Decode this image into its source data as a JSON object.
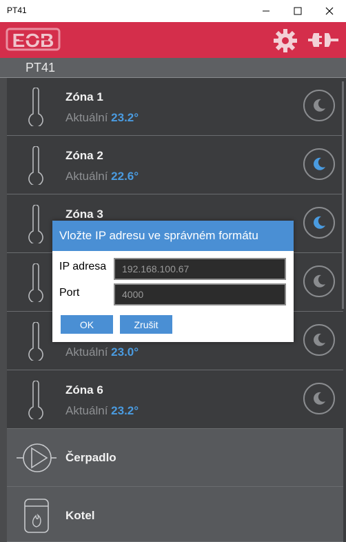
{
  "window": {
    "title": "PT41"
  },
  "header": {
    "logo_text": "EOB"
  },
  "subheader": {
    "title": "PT41"
  },
  "zones": [
    {
      "name": "Zóna 1",
      "status_label": "Aktuální",
      "temperature": "23.2°",
      "mode_active": false
    },
    {
      "name": "Zóna 2",
      "status_label": "Aktuální",
      "temperature": "22.6°",
      "mode_active": true
    },
    {
      "name": "Zóna 3",
      "status_label": "",
      "temperature": "",
      "mode_active": true
    },
    {
      "name": "",
      "status_label": "",
      "temperature": "",
      "mode_active": false
    },
    {
      "name": "",
      "status_label": "Aktuální",
      "temperature": "23.0°",
      "mode_active": false
    },
    {
      "name": "Zóna 6",
      "status_label": "Aktuální",
      "temperature": "23.2°",
      "mode_active": false
    }
  ],
  "devices": [
    {
      "name": "Čerpadlo",
      "icon": "pump-icon"
    },
    {
      "name": "Kotel",
      "icon": "boiler-icon"
    }
  ],
  "dialog": {
    "title": "Vložte IP adresu ve správném formátu",
    "ip_label": "IP adresa",
    "ip_value": "192.168.100.67",
    "port_label": "Port",
    "port_value": "4000",
    "ok_label": "OK",
    "cancel_label": "Zrušit"
  },
  "colors": {
    "header": "#d42e4b",
    "accent": "#4a8fd4",
    "temp": "#4a9be0",
    "background": "#3b3c3e"
  }
}
